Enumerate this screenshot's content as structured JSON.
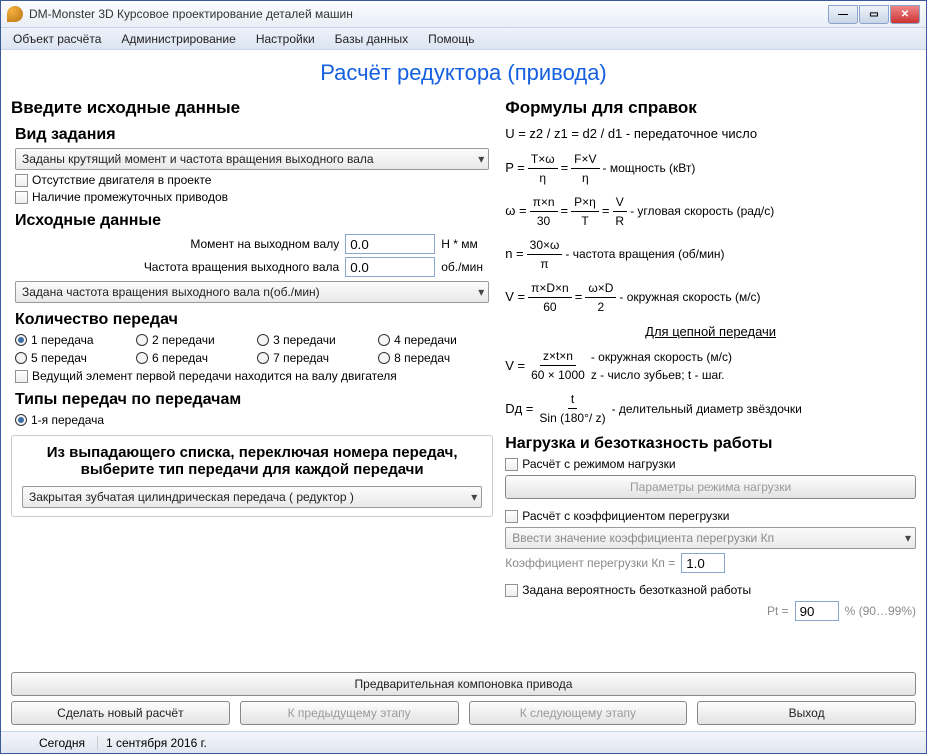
{
  "window": {
    "title": "DM-Monster 3D   Курсовое проектирование деталей машин"
  },
  "menu": [
    "Объект расчёта",
    "Администрирование",
    "Настройки",
    "Базы данных",
    "Помощь"
  ],
  "mainTitle": "Расчёт редуктора (привода)",
  "left": {
    "heading": "Введите исходные данные",
    "taskType": {
      "label": "Вид задания",
      "selected": "Заданы крутящий момент и частота вращения выходного вала"
    },
    "absenceMotor": "Отсутствие двигателя в проекте",
    "intermediate": "Наличие промежуточных приводов",
    "source": {
      "label": "Исходные данные",
      "momentLabel": "Момент на выходном валу",
      "momentValue": "0.0",
      "momentUnit": "Н * мм",
      "freqLabel": "Частота вращения выходного вала",
      "freqValue": "0.0",
      "freqUnit": "об./мин",
      "combo": "Задана частота вращения выходного вала n(об./мин)"
    },
    "gearCount": {
      "label": "Количество передач",
      "items": [
        "1 передача",
        "2 передачи",
        "3 передачи",
        "4 передачи",
        "5 передач",
        "6 передач",
        "7 передач",
        "8 передач"
      ],
      "leadingElem": "Ведущий элемент первой передачи находится на валу двигателя"
    },
    "gearTypes": {
      "label": "Типы передач по передачам",
      "first": "1-я передача"
    },
    "perGear": {
      "title1": "Из выпадающего списка, переключая номера передач,",
      "title2": "выберите тип передачи для каждой передачи",
      "selected": "Закрытая зубчатая цилиндрическая передача ( редуктор )"
    }
  },
  "right": {
    "heading": "Формулы для справок",
    "f1": "U = z2 / z1 = d2 / d1 - передаточное число",
    "power": {
      "lhs": "P =",
      "f1t": "T×ω",
      "f1b": "η",
      "eq": "=",
      "f2t": "F×V",
      "f2b": "η",
      "note": "- мощность (кВт)"
    },
    "omega": {
      "lhs": "ω =",
      "f1t": "π×n",
      "f1b": "30",
      "eq": "=",
      "f2t": "P×η",
      "f2b": "T",
      "eq2": "=",
      "f3t": "V",
      "f3b": "R",
      "note": "- угловая скорость (рад/с)"
    },
    "n": {
      "lhs": "n =",
      "f1t": "30×ω",
      "f1b": "π",
      "note": "- частота вращения (об/мин)"
    },
    "v": {
      "lhs": "V =",
      "f1t": "π×D×n",
      "f1b": "60",
      "eq": "=",
      "f2t": "ω×D",
      "f2b": "2",
      "note": "- окружная скорость (м/с)"
    },
    "chain": "Для цепной передачи",
    "v2": {
      "lhs": "V =",
      "f1t": "z×t×n",
      "f1b": "60 × 1000",
      "note": "- окружная скорость (м/с)",
      "note2": "z - число зубьев; t - шаг."
    },
    "dd": {
      "lhs": "Dд =",
      "f1t": "t",
      "f1b": "Sin (180°/ z)",
      "note": "- делительный диаметр звёздочки"
    },
    "load": {
      "heading": "Нагрузка и безотказность работы",
      "mode": "Расчёт с режимом нагрузки",
      "modeBtn": "Параметры режима нагрузки",
      "overload": "Расчёт с коэффициентом перегрузки",
      "overloadBtn": "Ввести значение коэффициента перегрузки Кп",
      "coefLabel": "Коэффициент перегрузки  Кп =",
      "coefValue": "1.0",
      "prob": "Задана вероятность безотказной работы",
      "ptLabel": "Pt =",
      "ptValue": "90",
      "ptUnit": "%   (90…99%)"
    }
  },
  "buttons": {
    "preview": "Предварительная компоновка привода",
    "new": "Сделать новый расчёт",
    "prev": "К предыдущему этапу",
    "next": "К следующему этапу",
    "exit": "Выход"
  },
  "status": {
    "today": "Сегодня",
    "date": "1 сентября 2016 г."
  }
}
